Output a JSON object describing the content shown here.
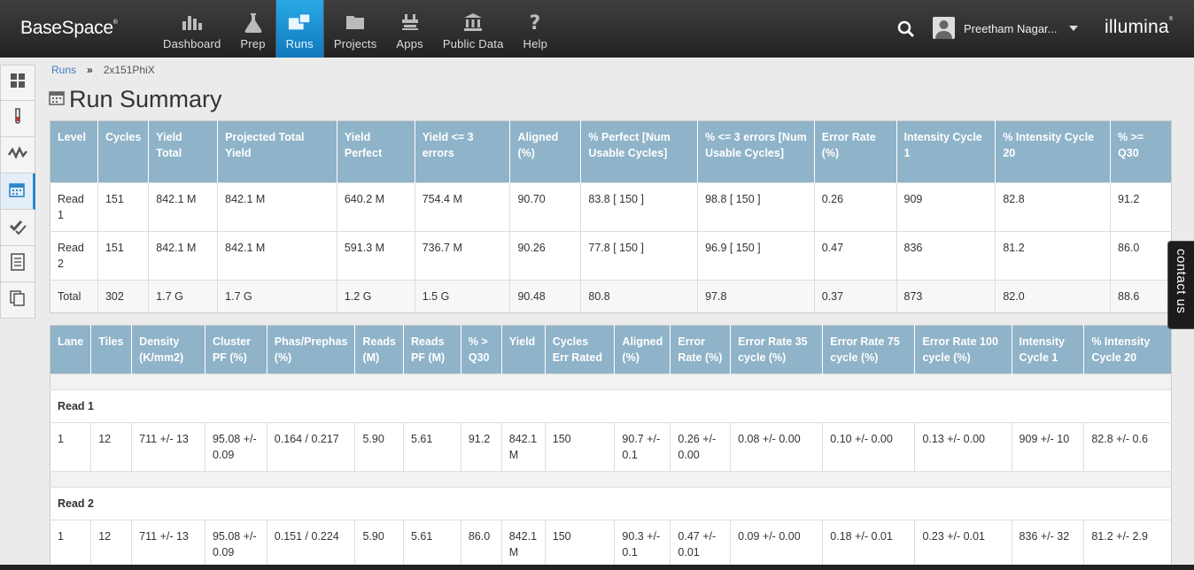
{
  "header": {
    "logo": "BaseSpace",
    "logo_mark": "®",
    "nav": [
      {
        "label": "Dashboard",
        "icon": "dashboard-icon"
      },
      {
        "label": "Prep",
        "icon": "flask-icon"
      },
      {
        "label": "Runs",
        "icon": "runs-icon",
        "active": true
      },
      {
        "label": "Projects",
        "icon": "folder-icon"
      },
      {
        "label": "Apps",
        "icon": "apps-icon"
      },
      {
        "label": "Public Data",
        "icon": "bank-icon"
      },
      {
        "label": "Help",
        "icon": "help-icon"
      }
    ],
    "user_name": "Preetham Nagar...",
    "brand": "illumina",
    "brand_mark": "®"
  },
  "breadcrumb": {
    "root": "Runs",
    "sep": "»",
    "current": "2x151PhiX"
  },
  "page_title": "Run Summary",
  "summary_table": {
    "headers": [
      "Level",
      "Cycles",
      "Yield Total",
      "Projected Total Yield",
      "Yield Perfect",
      "Yield <= 3 errors",
      "Aligned (%)",
      "% Perfect [Num Usable Cycles]",
      "% <= 3 errors [Num Usable Cycles]",
      "Error Rate (%)",
      "Intensity Cycle 1",
      "% Intensity Cycle 20",
      "% >= Q30"
    ],
    "rows": [
      [
        "Read 1",
        "151",
        "842.1 M",
        "842.1 M",
        "640.2 M",
        "754.4 M",
        "90.70",
        "83.8 [ 150 ]",
        "98.8 [ 150 ]",
        "0.26",
        "909",
        "82.8",
        "91.2"
      ],
      [
        "Read 2",
        "151",
        "842.1 M",
        "842.1 M",
        "591.3 M",
        "736.7 M",
        "90.26",
        "77.8 [ 150 ]",
        "96.9 [ 150 ]",
        "0.47",
        "836",
        "81.2",
        "86.0"
      ],
      [
        "Total",
        "302",
        "1.7 G",
        "1.7 G",
        "1.2 G",
        "1.5 G",
        "90.48",
        "80.8",
        "97.8",
        "0.37",
        "873",
        "82.0",
        "88.6"
      ]
    ]
  },
  "lane_table": {
    "headers": [
      "Lane",
      "Tiles",
      "Density (K/mm2)",
      "Cluster PF (%)",
      "Phas/Prephas (%)",
      "Reads (M)",
      "Reads PF (M)",
      "% > Q30",
      "Yield",
      "Cycles Err Rated",
      "Aligned (%)",
      "Error Rate (%)",
      "Error Rate 35 cycle (%)",
      "Error Rate 75 cycle (%)",
      "Error Rate 100 cycle (%)",
      "Intensity Cycle 1",
      "% Intensity Cycle 20"
    ],
    "groups": [
      {
        "label": "Read 1",
        "rows": [
          [
            "1",
            "12",
            "711 +/- 13",
            "95.08 +/- 0.09",
            "0.164 / 0.217",
            "5.90",
            "5.61",
            "91.2",
            "842.1 M",
            "150",
            "90.7 +/- 0.1",
            "0.26 +/- 0.00",
            "0.08 +/- 0.00",
            "0.10 +/- 0.00",
            "0.13 +/- 0.00",
            "909 +/- 10",
            "82.8 +/- 0.6"
          ]
        ]
      },
      {
        "label": "Read 2",
        "rows": [
          [
            "1",
            "12",
            "711 +/- 13",
            "95.08 +/- 0.09",
            "0.151 / 0.224",
            "5.90",
            "5.61",
            "86.0",
            "842.1 M",
            "150",
            "90.3 +/- 0.1",
            "0.47 +/- 0.01",
            "0.09 +/- 0.00",
            "0.18 +/- 0.01",
            "0.23 +/- 0.01",
            "836 +/- 32",
            "81.2 +/- 2.9"
          ]
        ]
      }
    ]
  },
  "sidebar": [
    {
      "icon": "grid-icon"
    },
    {
      "icon": "test-tube-icon"
    },
    {
      "icon": "chart-line-icon"
    },
    {
      "icon": "calendar-icon",
      "active": true
    },
    {
      "icon": "checklist-icon"
    },
    {
      "icon": "log-icon"
    },
    {
      "icon": "copy-icon"
    }
  ],
  "contact_label": "contact us",
  "colors": {
    "accent": "#1a8fd6",
    "table_header": "#8fb3c8",
    "topbar": "#2b2b2b"
  }
}
